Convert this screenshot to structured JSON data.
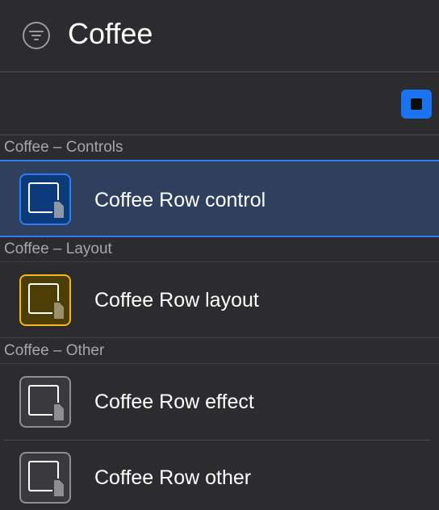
{
  "header": {
    "title": "Coffee",
    "filter_icon": "filter-icon"
  },
  "toolbar": {
    "stop_icon": "stop-icon",
    "accent_color": "#1a73f0"
  },
  "sections": [
    {
      "label": "Coffee – Controls",
      "rows": [
        {
          "label": "Coffee Row control",
          "icon": "document-icon",
          "icon_color": "#0d3a7a",
          "icon_border": "#2f7cf6",
          "selected": true
        }
      ]
    },
    {
      "label": "Coffee – Layout",
      "rows": [
        {
          "label": "Coffee Row layout",
          "icon": "document-icon",
          "icon_color": "#4d3e05",
          "icon_border": "#f2b61e",
          "selected": false
        }
      ]
    },
    {
      "label": "Coffee – Other",
      "rows": [
        {
          "label": "Coffee Row effect",
          "icon": "document-icon",
          "icon_color": "#3a3a3c",
          "icon_border": "#8e8e92",
          "selected": false
        },
        {
          "label": "Coffee Row other",
          "icon": "document-icon",
          "icon_color": "#3a3a3c",
          "icon_border": "#8e8e92",
          "selected": false
        }
      ]
    }
  ]
}
